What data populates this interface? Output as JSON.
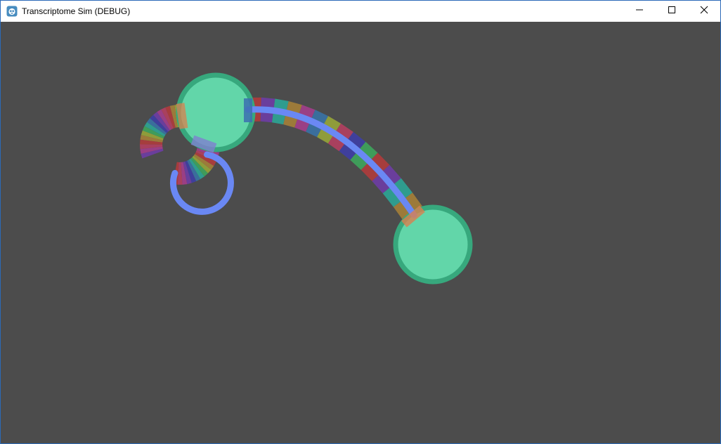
{
  "window": {
    "title": "Transcriptome Sim (DEBUG)",
    "app_icon": "godot-engine-icon",
    "controls": {
      "minimize_icon": "minimize-icon",
      "maximize_icon": "maximize-icon",
      "close_icon": "close-icon"
    }
  },
  "scene": {
    "background_color": "#4c4c4c",
    "node_fill": "#62d6a9",
    "node_border": "#37a87d",
    "path_line_color": "#6a88f4",
    "stripe_colors": [
      "#a63d3d",
      "#a9405e",
      "#9a3f85",
      "#6a3e9c",
      "#3f3f9c",
      "#3a6e9c",
      "#2f9c8e",
      "#3f9c5a",
      "#8f9c3a",
      "#9c7a3a"
    ]
  }
}
